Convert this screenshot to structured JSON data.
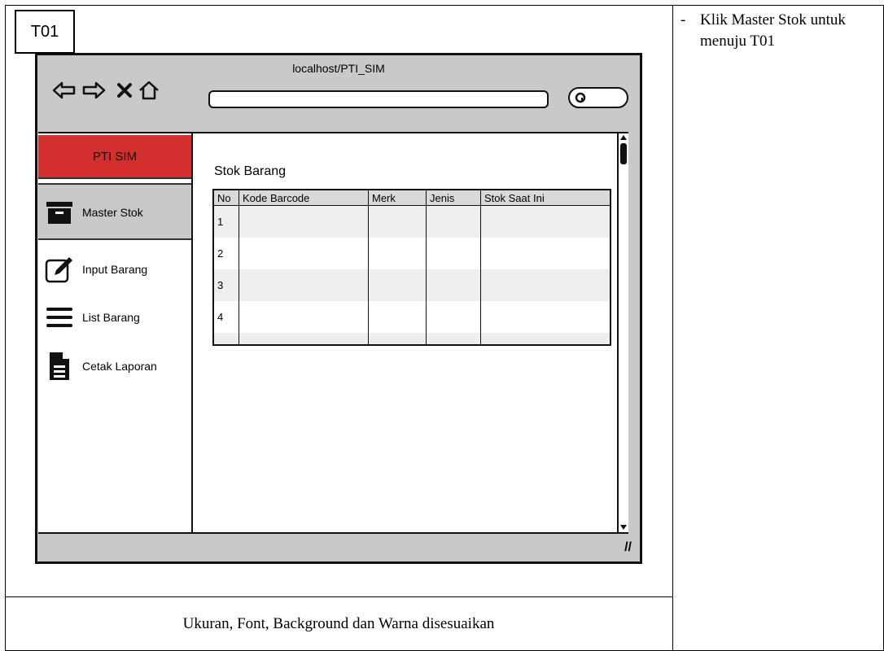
{
  "screen_id": "T01",
  "notes": [
    {
      "marker": "-",
      "text": "Klik Master Stok untuk menuju T01"
    }
  ],
  "caption": "Ukuran, Font, Background dan Warna disesuaikan",
  "browser": {
    "url": "localhost/PTI_SIM",
    "nav_icons": [
      "back-arrow-icon",
      "forward-arrow-icon",
      "close-icon",
      "home-icon"
    ],
    "search_icon": "search-icon",
    "status_icon": "resize-handle-icon"
  },
  "app": {
    "brand": "PTI SIM",
    "brand_color": "#d32f2f",
    "menu": [
      {
        "label": "Master Stok",
        "icon": "archive-box-icon",
        "active": true
      },
      {
        "label": "Input Barang",
        "icon": "edit-pencil-icon",
        "active": false
      },
      {
        "label": "List Barang",
        "icon": "list-icon",
        "active": false
      },
      {
        "label": "Cetak Laporan",
        "icon": "document-icon",
        "active": false
      }
    ],
    "page_title": "Stok Barang",
    "table": {
      "columns": [
        "No",
        "Kode Barcode",
        "Merk",
        "Jenis",
        "Stok Saat Ini"
      ],
      "rows": [
        [
          "1",
          "",
          "",
          "",
          ""
        ],
        [
          "2",
          "",
          "",
          "",
          ""
        ],
        [
          "3",
          "",
          "",
          "",
          ""
        ],
        [
          "4",
          "",
          "",
          "",
          ""
        ]
      ]
    }
  }
}
